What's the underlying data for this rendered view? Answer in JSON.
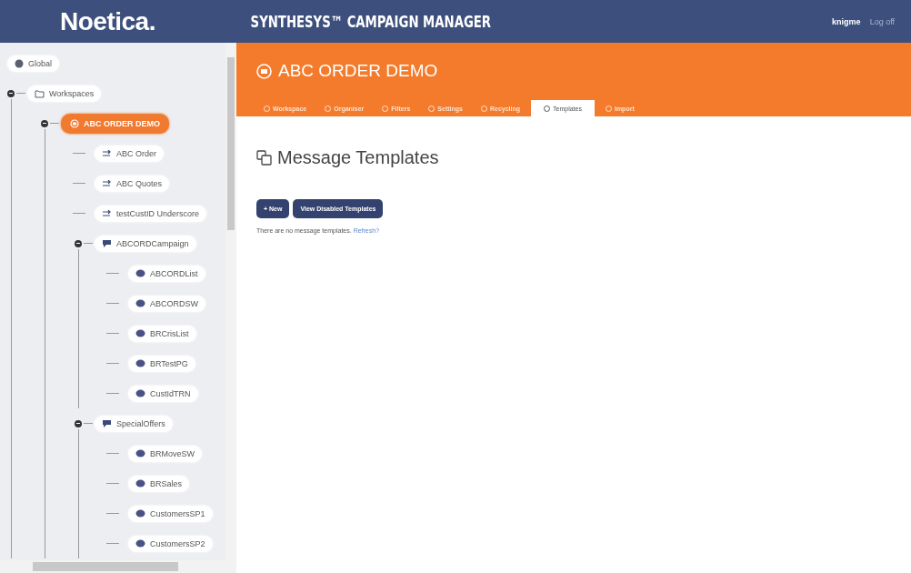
{
  "header": {
    "logo": "Noetica.",
    "app_title": "SYNTHESYS™ CAMPAIGN MANAGER",
    "user": "knigme",
    "logoff": "Log off"
  },
  "sidebar": {
    "tree": [
      {
        "label": "Global",
        "kind": "globe",
        "selected": false
      },
      {
        "label": "Workspaces",
        "kind": "folder",
        "selected": false,
        "expanded": true,
        "children": [
          {
            "label": "ABC ORDER DEMO",
            "kind": "workspace",
            "selected": true,
            "expanded": true,
            "children": [
              {
                "label": "ABC Order",
                "kind": "link",
                "selected": false
              },
              {
                "label": "ABC Quotes",
                "kind": "link",
                "selected": false
              },
              {
                "label": "testCustID Underscore",
                "kind": "link",
                "selected": false
              },
              {
                "label": "ABCORDCampaign",
                "kind": "campaign",
                "selected": false,
                "expanded": true,
                "children": [
                  {
                    "label": "ABCORDList",
                    "kind": "list",
                    "selected": false
                  },
                  {
                    "label": "ABCORDSW",
                    "kind": "list",
                    "selected": false
                  },
                  {
                    "label": "BRCrisList",
                    "kind": "list",
                    "selected": false
                  },
                  {
                    "label": "BRTestPG",
                    "kind": "list",
                    "selected": false
                  },
                  {
                    "label": "CustIdTRN",
                    "kind": "list",
                    "selected": false
                  }
                ]
              },
              {
                "label": "SpecialOffers",
                "kind": "campaign",
                "selected": false,
                "expanded": true,
                "children": [
                  {
                    "label": "BRMoveSW",
                    "kind": "list",
                    "selected": false
                  },
                  {
                    "label": "BRSales",
                    "kind": "list",
                    "selected": false
                  },
                  {
                    "label": "CustomersSP1",
                    "kind": "list",
                    "selected": false
                  },
                  {
                    "label": "CustomersSP2",
                    "kind": "list",
                    "selected": false
                  }
                ]
              }
            ]
          }
        ]
      }
    ]
  },
  "workspace": {
    "title": "ABC ORDER DEMO",
    "tabs": [
      {
        "label": "Workspace",
        "selected": false
      },
      {
        "label": "Organiser",
        "selected": false
      },
      {
        "label": "Filters",
        "selected": false
      },
      {
        "label": "Settings",
        "selected": false
      },
      {
        "label": "Recycling",
        "selected": false
      },
      {
        "label": "Templates",
        "selected": true
      },
      {
        "label": "Import",
        "selected": false
      }
    ]
  },
  "content": {
    "heading": "Message Templates",
    "buttons": [
      "+ New",
      "View Disabled Templates"
    ],
    "message": "There are no message templates.",
    "refresh_link": "Refresh?"
  }
}
